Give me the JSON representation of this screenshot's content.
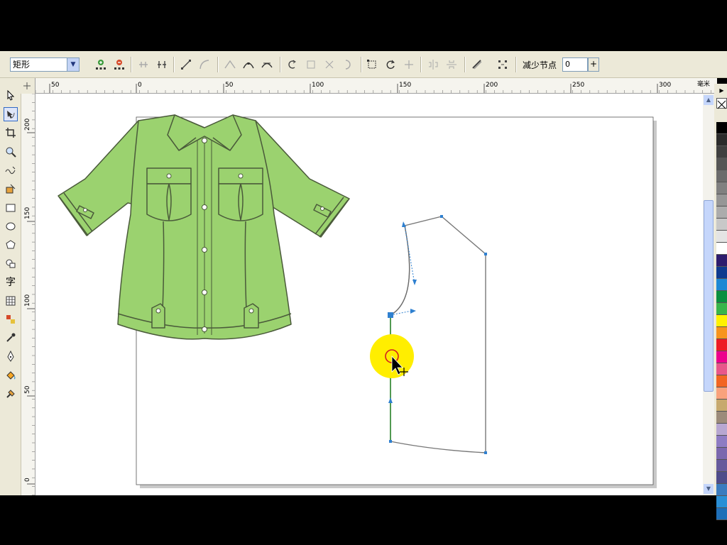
{
  "property_bar": {
    "shape_type": "矩形",
    "reduce_nodes_label": "减少节点",
    "reduce_nodes_value": "0",
    "spin_symbol": "+"
  },
  "ruler": {
    "unit": "毫米",
    "h_ticks": [
      "50",
      "0",
      "50",
      "100",
      "150",
      "200",
      "250",
      "300"
    ],
    "v_ticks": [
      "200",
      "150",
      "100",
      "50",
      "0"
    ]
  },
  "toolbox": {
    "text_tool_glyph": "字"
  },
  "palette": {
    "colors": [
      "#000000",
      "#2b2b2b",
      "#3f3f3f",
      "#555555",
      "#6b6b6b",
      "#808080",
      "#969696",
      "#acacac",
      "#c8c8c8",
      "#e4e4e4",
      "#ffffff",
      "#2e1c6e",
      "#0f3b8f",
      "#1e88d4",
      "#0a8f3f",
      "#39b54a",
      "#fff200",
      "#f7941d",
      "#ed1c24",
      "#ec008c",
      "#e8568a",
      "#f26522",
      "#f9a27c",
      "#c7a96e",
      "#9c8b7a",
      "#b7a7d1",
      "#8e7cc3",
      "#7b68ae",
      "#665a9c",
      "#4e4b8a",
      "#3a7bbf",
      "#2a8fd6",
      "#1f6fb8"
    ]
  }
}
